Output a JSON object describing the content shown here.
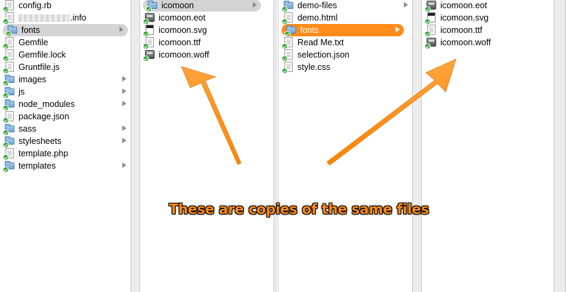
{
  "column1": {
    "items": [
      {
        "label": "config.rb",
        "icon": "document-icon",
        "chevron": false
      },
      {
        "label": ".info",
        "icon": "document-icon",
        "chevron": false,
        "redacted": true
      },
      {
        "label": "fonts",
        "icon": "folder-icon",
        "chevron": true,
        "selected": "gray"
      },
      {
        "label": "Gemfile",
        "icon": "document-icon",
        "chevron": false
      },
      {
        "label": "Gemfile.lock",
        "icon": "document-icon",
        "chevron": false
      },
      {
        "label": "Gruntfile.js",
        "icon": "document-icon",
        "chevron": false
      },
      {
        "label": "images",
        "icon": "folder-icon",
        "chevron": true
      },
      {
        "label": "js",
        "icon": "folder-icon",
        "chevron": true
      },
      {
        "label": "node_modules",
        "icon": "folder-icon",
        "chevron": true
      },
      {
        "label": "package.json",
        "icon": "document-icon",
        "chevron": false
      },
      {
        "label": "sass",
        "icon": "folder-icon",
        "chevron": true
      },
      {
        "label": "stylesheets",
        "icon": "folder-icon",
        "chevron": true
      },
      {
        "label": "template.php",
        "icon": "document-icon",
        "chevron": false
      },
      {
        "label": "templates",
        "icon": "folder-icon",
        "chevron": true
      }
    ]
  },
  "column2": {
    "items": [
      {
        "label": "icomoon",
        "icon": "folder-icon",
        "chevron": true,
        "selected": "gray"
      },
      {
        "label": "icomoon.eot",
        "icon": "font-file-icon",
        "chevron": false
      },
      {
        "label": "icomoon.svg",
        "icon": "svg-file-icon",
        "chevron": false
      },
      {
        "label": "icomoon.ttf",
        "icon": "document-icon",
        "chevron": false
      },
      {
        "label": "icomoon.woff",
        "icon": "font-file-icon",
        "chevron": false
      }
    ]
  },
  "column3": {
    "items": [
      {
        "label": "demo-files",
        "icon": "folder-icon",
        "chevron": true
      },
      {
        "label": "demo.html",
        "icon": "document-icon",
        "chevron": false
      },
      {
        "label": "fonts",
        "icon": "folder-icon",
        "chevron": true,
        "selected": "orange"
      },
      {
        "label": "Read Me.txt",
        "icon": "document-icon",
        "chevron": false
      },
      {
        "label": "selection.json",
        "icon": "document-icon",
        "chevron": false
      },
      {
        "label": "style.css",
        "icon": "document-icon",
        "chevron": false
      }
    ]
  },
  "column4": {
    "items": [
      {
        "label": "icomoon.eot",
        "icon": "font-file-icon",
        "chevron": false
      },
      {
        "label": "icomoon.svg",
        "icon": "svg-file-icon",
        "chevron": false
      },
      {
        "label": "icomoon.ttf",
        "icon": "document-icon",
        "chevron": false
      },
      {
        "label": "icomoon.woff",
        "icon": "font-file-icon",
        "chevron": false
      }
    ]
  },
  "annotation": {
    "text": "These are copies of the same files",
    "color": "#ff8a1a"
  },
  "colors": {
    "selection_gray": "#d4d4d4",
    "selection_orange": "#ff8c1a"
  }
}
